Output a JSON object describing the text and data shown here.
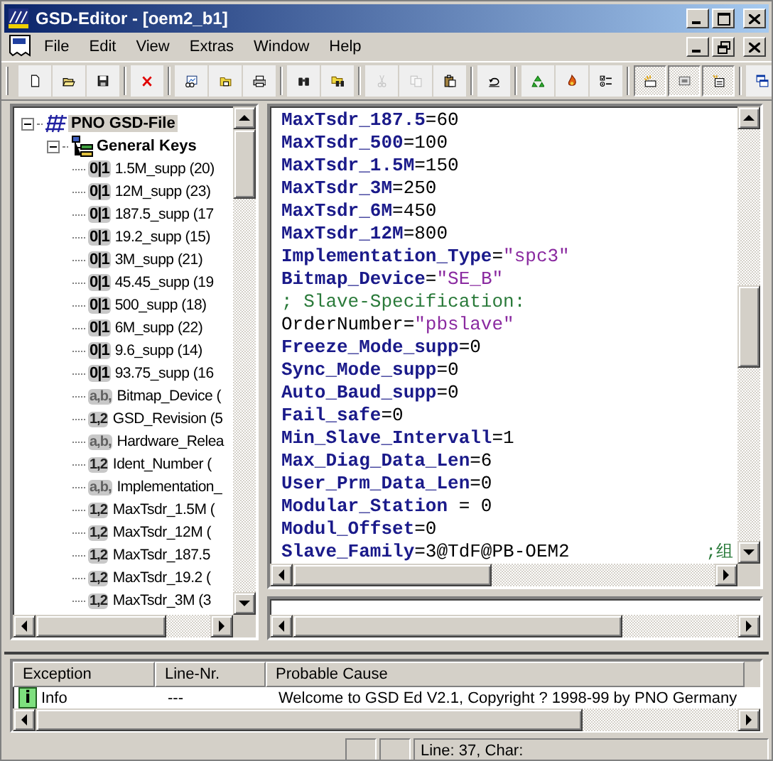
{
  "window": {
    "title": "GSD-Editor - [oem2_b1]"
  },
  "menu": [
    {
      "label": "File"
    },
    {
      "label": "Edit"
    },
    {
      "label": "View"
    },
    {
      "label": "Extras"
    },
    {
      "label": "Window"
    },
    {
      "label": "Help"
    }
  ],
  "toolbar": [
    [
      {
        "kind": "new",
        "disabled": false,
        "pressed": false
      },
      {
        "kind": "open",
        "disabled": false,
        "pressed": false
      },
      {
        "kind": "save",
        "disabled": false,
        "pressed": false
      }
    ],
    [
      {
        "kind": "delete",
        "disabled": false,
        "pressed": false
      }
    ],
    [
      {
        "kind": "image",
        "disabled": false,
        "pressed": false
      },
      {
        "kind": "folder",
        "disabled": false,
        "pressed": false
      },
      {
        "kind": "print",
        "disabled": false,
        "pressed": false
      }
    ],
    [
      {
        "kind": "find",
        "disabled": false,
        "pressed": false
      },
      {
        "kind": "find-folder",
        "disabled": false,
        "pressed": false
      }
    ],
    [
      {
        "kind": "cut",
        "disabled": true,
        "pressed": false
      },
      {
        "kind": "copy",
        "disabled": true,
        "pressed": false
      },
      {
        "kind": "paste",
        "disabled": false,
        "pressed": false
      }
    ],
    [
      {
        "kind": "undo",
        "disabled": false,
        "pressed": false
      }
    ],
    [
      {
        "kind": "recycle",
        "disabled": false,
        "pressed": false
      },
      {
        "kind": "flame",
        "disabled": false,
        "pressed": false
      },
      {
        "kind": "checklist",
        "disabled": false,
        "pressed": false
      }
    ],
    [
      {
        "kind": "lamp",
        "disabled": false,
        "pressed": true
      },
      {
        "kind": "display",
        "disabled": false,
        "pressed": true
      },
      {
        "kind": "card",
        "disabled": false,
        "pressed": true
      }
    ],
    [
      {
        "kind": "windows",
        "disabled": false,
        "pressed": false
      }
    ]
  ],
  "tree": [
    {
      "label": "PNO GSD-File",
      "kind": "file",
      "expanded": true,
      "selected": true,
      "children": [
        {
          "label": "General Keys",
          "kind": "group",
          "expanded": true,
          "selected": false,
          "children": [
            {
              "label": "1.5M_supp (20)",
              "kind": "bool",
              "badge": "0|1",
              "selected": false
            },
            {
              "label": "12M_supp (23)",
              "kind": "bool",
              "badge": "0|1",
              "selected": false
            },
            {
              "label": "187.5_supp (17",
              "kind": "bool",
              "badge": "0|1",
              "selected": false
            },
            {
              "label": "19.2_supp (15)",
              "kind": "bool",
              "badge": "0|1",
              "selected": false
            },
            {
              "label": "3M_supp (21)",
              "kind": "bool",
              "badge": "0|1",
              "selected": false
            },
            {
              "label": "45.45_supp (19",
              "kind": "bool",
              "badge": "0|1",
              "selected": false
            },
            {
              "label": "500_supp (18)",
              "kind": "bool",
              "badge": "0|1",
              "selected": false
            },
            {
              "label": "6M_supp (22)",
              "kind": "bool",
              "badge": "0|1",
              "selected": false
            },
            {
              "label": "9.6_supp (14)",
              "kind": "bool",
              "badge": "0|1",
              "selected": false
            },
            {
              "label": "93.75_supp (16",
              "kind": "bool",
              "badge": "0|1",
              "selected": false
            },
            {
              "label": "Bitmap_Device (",
              "kind": "text",
              "badge": "a,b,",
              "selected": false
            },
            {
              "label": "GSD_Revision (5",
              "kind": "number",
              "badge": "1,2",
              "selected": false
            },
            {
              "label": "Hardware_Relea",
              "kind": "text",
              "badge": "a,b,",
              "selected": false
            },
            {
              "label": "Ident_Number (",
              "kind": "number",
              "badge": "1,2",
              "selected": false
            },
            {
              "label": "Implementation_",
              "kind": "text",
              "badge": "a,b,",
              "selected": false
            },
            {
              "label": "MaxTsdr_1.5M (",
              "kind": "number",
              "badge": "1,2",
              "selected": false
            },
            {
              "label": "MaxTsdr_12M (",
              "kind": "number",
              "badge": "1,2",
              "selected": false
            },
            {
              "label": "MaxTsdr_187.5",
              "kind": "number",
              "badge": "1,2",
              "selected": false
            },
            {
              "label": "MaxTsdr_19.2 (",
              "kind": "number",
              "badge": "1,2",
              "selected": false
            },
            {
              "label": "MaxTsdr_3M (3",
              "kind": "number",
              "badge": "1,2",
              "selected": false
            }
          ]
        }
      ]
    }
  ],
  "editor": {
    "lines": [
      {
        "parts": [
          {
            "text": "MaxTsdr_187.5",
            "kind": "key"
          },
          {
            "text": "=60",
            "kind": "plain"
          }
        ]
      },
      {
        "parts": [
          {
            "text": "MaxTsdr_500",
            "kind": "key"
          },
          {
            "text": "=100",
            "kind": "plain"
          }
        ]
      },
      {
        "parts": [
          {
            "text": "MaxTsdr_1.5M",
            "kind": "key"
          },
          {
            "text": "=150",
            "kind": "plain"
          }
        ]
      },
      {
        "parts": [
          {
            "text": "MaxTsdr_3M",
            "kind": "key"
          },
          {
            "text": "=250",
            "kind": "plain"
          }
        ]
      },
      {
        "parts": [
          {
            "text": "MaxTsdr_6M",
            "kind": "key"
          },
          {
            "text": "=450",
            "kind": "plain"
          }
        ]
      },
      {
        "parts": [
          {
            "text": "MaxTsdr_12M",
            "kind": "key"
          },
          {
            "text": "=800",
            "kind": "plain"
          }
        ]
      },
      {
        "parts": [
          {
            "text": "Implementation_Type",
            "kind": "key"
          },
          {
            "text": "=",
            "kind": "plain"
          },
          {
            "text": "\"spc3\"",
            "kind": "string"
          }
        ]
      },
      {
        "parts": [
          {
            "text": "Bitmap_Device",
            "kind": "key"
          },
          {
            "text": "=",
            "kind": "plain"
          },
          {
            "text": "\"SE_B\"",
            "kind": "string"
          }
        ]
      },
      {
        "parts": [
          {
            "text": "; Slave-Specification:",
            "kind": "comment"
          }
        ]
      },
      {
        "parts": [
          {
            "text": "OrderNumber=",
            "kind": "plain"
          },
          {
            "text": "\"pbslave\"",
            "kind": "string"
          }
        ]
      },
      {
        "parts": [
          {
            "text": "Freeze_Mode_supp",
            "kind": "key"
          },
          {
            "text": "=0",
            "kind": "plain"
          }
        ]
      },
      {
        "parts": [
          {
            "text": "Sync_Mode_supp",
            "kind": "key"
          },
          {
            "text": "=0",
            "kind": "plain"
          }
        ]
      },
      {
        "parts": [
          {
            "text": "Auto_Baud_supp",
            "kind": "key"
          },
          {
            "text": "=0",
            "kind": "plain"
          }
        ]
      },
      {
        "parts": [
          {
            "text": "Fail_safe",
            "kind": "key"
          },
          {
            "text": "=0",
            "kind": "plain"
          }
        ]
      },
      {
        "parts": [
          {
            "text": "Min_Slave_Intervall",
            "kind": "key"
          },
          {
            "text": "=1",
            "kind": "plain"
          }
        ]
      },
      {
        "parts": [
          {
            "text": "Max_Diag_Data_Len",
            "kind": "key"
          },
          {
            "text": "=6",
            "kind": "plain"
          }
        ]
      },
      {
        "parts": [
          {
            "text": "User_Prm_Data_Len",
            "kind": "key"
          },
          {
            "text": "=0",
            "kind": "plain"
          }
        ]
      },
      {
        "parts": [
          {
            "text": "Modular_Station",
            "kind": "key"
          },
          {
            "text": " = 0",
            "kind": "plain"
          }
        ]
      },
      {
        "parts": [
          {
            "text": "Modul_Offset",
            "kind": "key"
          },
          {
            "text": "=0",
            "kind": "plain"
          }
        ]
      },
      {
        "parts": [
          {
            "text": "Slave_Family",
            "kind": "key"
          },
          {
            "text": "=3@TdF@PB-OEM2",
            "kind": "plain"
          }
        ],
        "trailing_comment": ";组"
      }
    ]
  },
  "messages": {
    "columns": [
      "Exception",
      "Line-Nr.",
      "Probable Cause"
    ],
    "rows": [
      {
        "badge": "i",
        "exception": "Info",
        "line": "---",
        "cause": "Welcome to GSD  Ed V2.1, Copyright ? 1998-99 by PNO Germany"
      }
    ]
  },
  "status_bar": {
    "position": "Line: 37, Char:"
  }
}
